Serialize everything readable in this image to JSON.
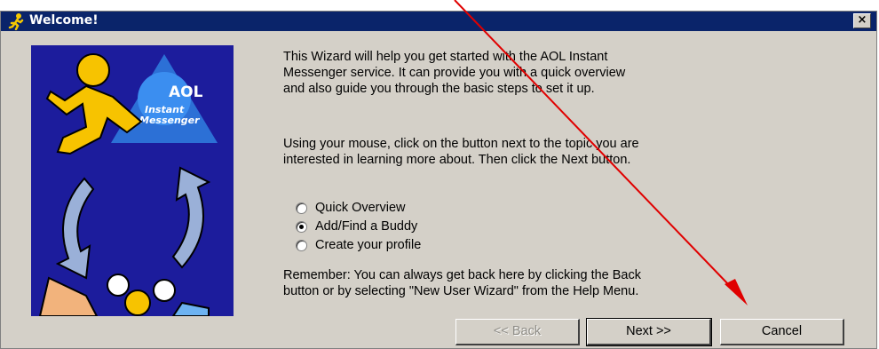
{
  "window": {
    "title": "Welcome!",
    "close_label": "×"
  },
  "banner": {
    "logo_brand": "AOL",
    "logo_line1": "Instant",
    "logo_line2": "Messenger"
  },
  "intro": [
    "This Wizard will help you get started with the AOL Instant",
    "Messenger service.  It can provide you with a quick overview",
    "and also guide you through the basic steps to set it up."
  ],
  "instructions": [
    "Using your mouse, click on the button next to the topic you are",
    "interested in learning more about.  Then click the Next button."
  ],
  "options": [
    {
      "label": "Quick Overview",
      "checked": false
    },
    {
      "label": "Add/Find a Buddy",
      "checked": true
    },
    {
      "label": "Create your profile",
      "checked": false
    }
  ],
  "reminder": [
    "Remember:  You can always get back here by clicking the Back",
    "button or by selecting \"New User Wizard\" from the Help Menu."
  ],
  "buttons": {
    "back": "<< Back",
    "next": "Next >>",
    "cancel": "Cancel"
  },
  "annotation": {
    "arrow_color": "#e00000"
  }
}
